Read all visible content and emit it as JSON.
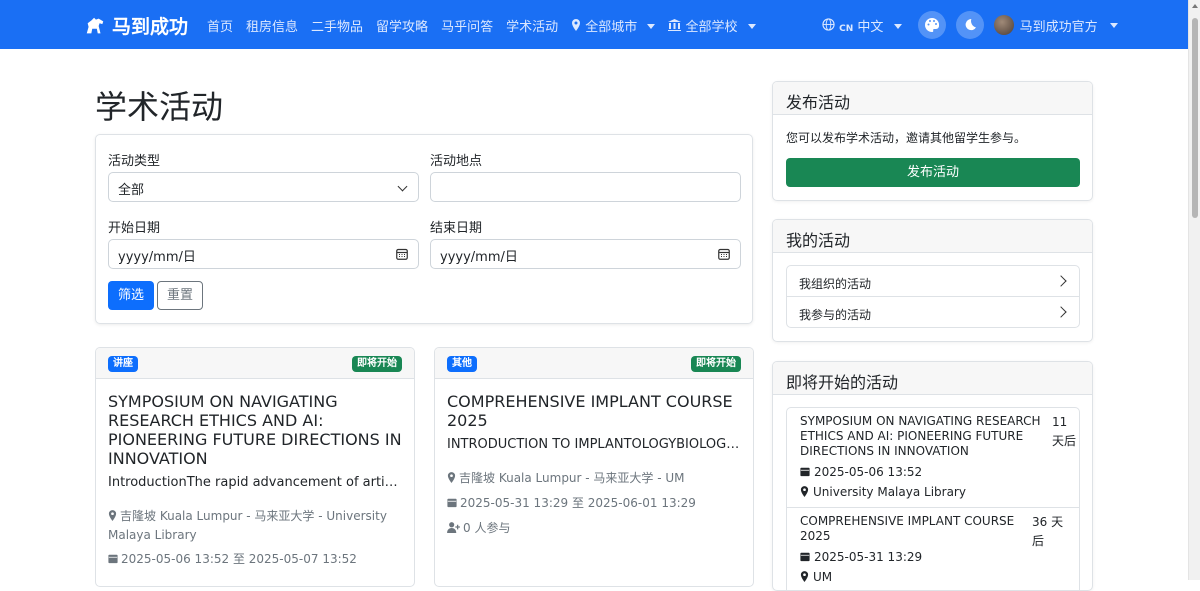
{
  "nav": {
    "brand": "马到成功",
    "links": [
      "首页",
      "租房信息",
      "二手物品",
      "留学攻略",
      "马乎问答",
      "学术活动"
    ],
    "city": "全部城市",
    "school": "全部学校",
    "lang_code": "CN",
    "lang": "中文",
    "user": "马到成功官方"
  },
  "page": {
    "title": "学术活动"
  },
  "filter": {
    "type_label": "活动类型",
    "type_value": "全部",
    "location_label": "活动地点",
    "location_value": "",
    "start_label": "开始日期",
    "start_value": "yyyy/mm/日",
    "end_label": "结束日期",
    "end_value": "yyyy/mm/日",
    "submit": "筛选",
    "reset": "重置"
  },
  "events": [
    {
      "category": "讲座",
      "status": "即将开始",
      "title": "SYMPOSIUM ON NAVIGATING RESEARCH ETHICS AND AI: PIONEERING FUTURE DIRECTIONS IN INNOVATION",
      "desc": "IntroductionThe rapid advancement of artificial intelligence",
      "location": "吉隆坡 Kuala Lumpur - 马来亚大学 - University Malaya Library",
      "time": "2025-05-06 13:52 至 2025-05-07 13:52"
    },
    {
      "category": "其他",
      "status": "即将开始",
      "title": "COMPREHENSIVE IMPLANT COURSE 2025",
      "desc": "INTRODUCTION TO IMPLANTOLOGYBIOLOGICAL PRINCIPLES",
      "location": "吉隆坡 Kuala Lumpur - 马来亚大学 - UM",
      "time": "2025-05-31 13:29 至 2025-06-01 13:29",
      "participants": "0 人参与"
    }
  ],
  "sidebar": {
    "publish": {
      "title": "发布活动",
      "text": "您可以发布学术活动，邀请其他留学生参与。",
      "button": "发布活动"
    },
    "mine": {
      "title": "我的活动",
      "organized": "我组织的活动",
      "joined": "我参与的活动"
    },
    "upcoming": {
      "title": "即将开始的活动",
      "items": [
        {
          "title": "SYMPOSIUM ON NAVIGATING RESEARCH ETHICS AND AI: PIONEERING FUTURE DIRECTIONS IN INNOVATION",
          "days": "11 天后",
          "date": "2025-05-06 13:52",
          "place": "University Malaya Library"
        },
        {
          "title": "COMPREHENSIVE IMPLANT COURSE 2025",
          "days": "36 天后",
          "date": "2025-05-31 13:29",
          "place": "UM"
        }
      ]
    }
  },
  "colors": {
    "primary": "#0d6efd",
    "navbar": "#1a6ff4",
    "success": "#198754"
  }
}
